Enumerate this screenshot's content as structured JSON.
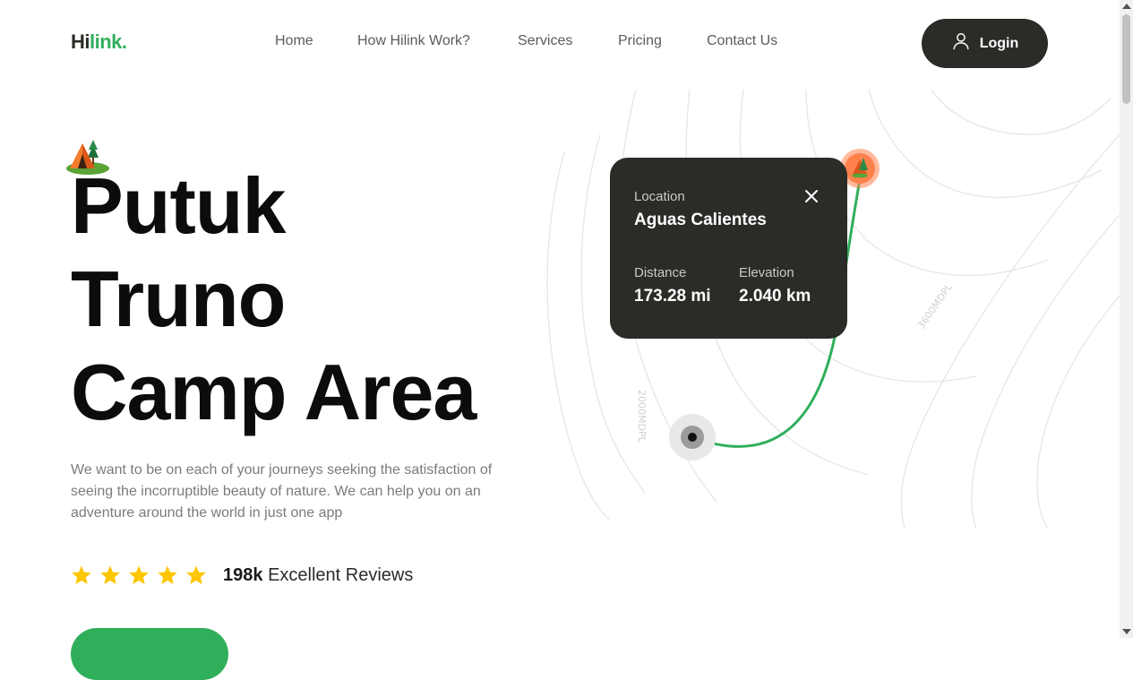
{
  "brand": {
    "logo_part1": "Hi",
    "logo_part2": "link."
  },
  "nav": {
    "items": [
      {
        "label": "Home"
      },
      {
        "label": "How Hilink Work?"
      },
      {
        "label": "Services"
      },
      {
        "label": "Pricing"
      },
      {
        "label": "Contact Us"
      }
    ]
  },
  "header": {
    "login_label": "Login",
    "login_icon": "user-icon"
  },
  "hero": {
    "title_lines": [
      "Putuk",
      "Truno",
      "Camp Area"
    ],
    "description": "We want to be on each of your journeys seeking the satisfaction of seeing the incorruptible beauty of nature. We can help you on an adventure around the world in just one app",
    "rating": {
      "stars": 5,
      "count": "198k",
      "label": "Excellent Reviews"
    },
    "icon": "camp-tent-icon"
  },
  "map": {
    "contour_labels": [
      "2000MDPL",
      "3600MDPL"
    ],
    "route_color": "#30af5b"
  },
  "location_card": {
    "location_label": "Location",
    "location_value": "Aguas Calientes",
    "distance_label": "Distance",
    "distance_value": "173.28 mi",
    "elevation_label": "Elevation",
    "elevation_value": "2.040 km",
    "close_icon": "close-icon"
  },
  "colors": {
    "accent": "#30af5b",
    "dark": "#292c27",
    "star": "#fec601",
    "pin": "#ff814c"
  }
}
